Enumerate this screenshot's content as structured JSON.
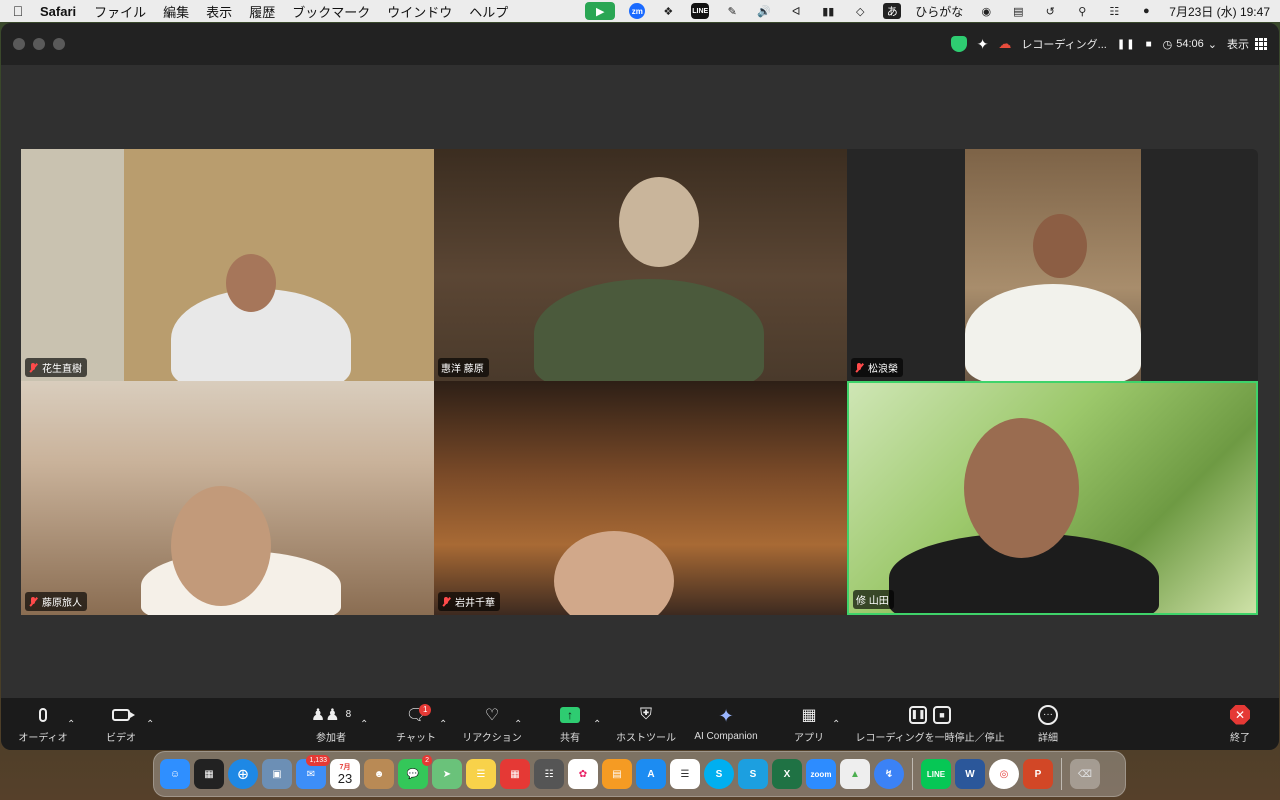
{
  "menubar": {
    "app_name": "Safari",
    "menus": [
      "ファイル",
      "編集",
      "表示",
      "履歴",
      "ブックマーク",
      "ウインドウ",
      "ヘルプ"
    ],
    "ime_label": "あ",
    "ime_mode": "ひらがな",
    "datetime": "7月23日 (水)  19:47"
  },
  "titlebar": {
    "recording_label": "レコーディング...",
    "elapsed": "54:06",
    "view_label": "表示"
  },
  "participants": [
    {
      "name": "花生直樹",
      "muted": true
    },
    {
      "name": "惠洋 藤原",
      "muted": false
    },
    {
      "name": "松浪榮",
      "muted": true
    },
    {
      "name": "藤原旅人",
      "muted": true
    },
    {
      "name": "岩井千華",
      "muted": true
    },
    {
      "name": "修 山田",
      "muted": false,
      "active_speaker": true
    }
  ],
  "controls": {
    "audio": "オーディオ",
    "video": "ビデオ",
    "participants": "参加者",
    "participants_count": "8",
    "chat": "チャット",
    "chat_badge": "1",
    "reactions": "リアクション",
    "share": "共有",
    "host_tools": "ホストツール",
    "ai_companion": "AI Companion",
    "apps": "アプリ",
    "recording": "レコーディングを一時停止／停止",
    "more": "詳細",
    "end": "終了"
  },
  "dock": {
    "mail_badge": "1,133",
    "calendar_month": "7月",
    "calendar_day": "23",
    "messages_badge": "2",
    "zoom_label": "zoom"
  },
  "colors": {
    "active_speaker_border": "#3fd36a",
    "share_green": "#2ecc71",
    "end_red": "#e53935",
    "window_bg": "#303030"
  }
}
